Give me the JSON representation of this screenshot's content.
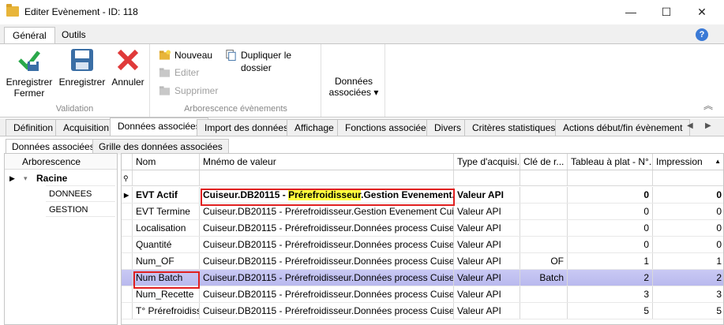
{
  "window": {
    "title": "Editer Evènement - ID: 118"
  },
  "ribbon_tabs": [
    "Général",
    "Outils"
  ],
  "ribbon": {
    "validation": {
      "save_close": "Enregistrer\nFermer",
      "save": "Enregistrer",
      "cancel": "Annuler",
      "label": "Validation"
    },
    "tree": {
      "new": "Nouveau",
      "edit": "Editer",
      "delete": "Supprimer",
      "duplicate": "Dupliquer le dossier",
      "label": "Arborescence évènements"
    },
    "assoc": {
      "label": "Données\nassociées ▾"
    }
  },
  "main_tabs": [
    "Définition",
    "Acquisition",
    "Données associées",
    "Import des données",
    "Affichage",
    "Fonctions associées",
    "Divers",
    "Critères statistiques",
    "Actions début/fin évènement"
  ],
  "sub_tabs": [
    "Données associées",
    "Grille des données associées"
  ],
  "tree": {
    "header": "Arborescence",
    "root": "Racine",
    "children": [
      "DONNEES",
      "GESTION"
    ]
  },
  "grid": {
    "columns": [
      "Nom",
      "Mnémo de valeur",
      "Type d'acquisi...",
      "Clé de r...",
      "Tableau à plat - N°...",
      "Impression"
    ],
    "sort_indicator": "▲",
    "rows": [
      {
        "nom": "EVT Actif",
        "mnemo_a": "Cuiseur.DB20115 - ",
        "mnemo_hl": "Prérefroidisseur",
        "mnemo_b": ".Gestion Evenement...",
        "type": "Valeur API",
        "cle": "",
        "tab": "0",
        "imp": "0"
      },
      {
        "nom": "EVT Termine",
        "mnemo_a": "Cuiseur.DB20115 - Prérefroidisseur.Gestion Evenement Cuiseur...",
        "mnemo_hl": "",
        "mnemo_b": "",
        "type": "Valeur API",
        "cle": "",
        "tab": "0",
        "imp": "0"
      },
      {
        "nom": "Localisation",
        "mnemo_a": "Cuiseur.DB20115 - Prérefroidisseur.Données process Cuiseur P...",
        "mnemo_hl": "",
        "mnemo_b": "",
        "type": "Valeur API",
        "cle": "",
        "tab": "0",
        "imp": "0"
      },
      {
        "nom": "Quantité",
        "mnemo_a": "Cuiseur.DB20115 - Prérefroidisseur.Données process Cuiseur P...",
        "mnemo_hl": "",
        "mnemo_b": "",
        "type": "Valeur API",
        "cle": "",
        "tab": "0",
        "imp": "0"
      },
      {
        "nom": "Num_OF",
        "mnemo_a": "Cuiseur.DB20115 - Prérefroidisseur.Données process Cuiseur P...",
        "mnemo_hl": "",
        "mnemo_b": "",
        "type": "Valeur API",
        "cle": "OF",
        "tab": "1",
        "imp": "1"
      },
      {
        "nom": "Num Batch",
        "mnemo_a": "Cuiseur.DB20115 - Prérefroidisseur.Données process Cuiseur P...",
        "mnemo_hl": "",
        "mnemo_b": "",
        "type": "Valeur API",
        "cle": "Batch",
        "tab": "2",
        "imp": "2"
      },
      {
        "nom": "Num_Recette",
        "mnemo_a": "Cuiseur.DB20115 - Prérefroidisseur.Données process Cuiseur P...",
        "mnemo_hl": "",
        "mnemo_b": "",
        "type": "Valeur API",
        "cle": "",
        "tab": "3",
        "imp": "3"
      },
      {
        "nom": "T° Prérefroidiss",
        "mnemo_a": "Cuiseur.DB20115 - Prérefroidisseur.Données process Cuiseur P...",
        "mnemo_hl": "",
        "mnemo_b": "",
        "type": "Valeur API",
        "cle": "",
        "tab": "5",
        "imp": "5"
      }
    ]
  }
}
